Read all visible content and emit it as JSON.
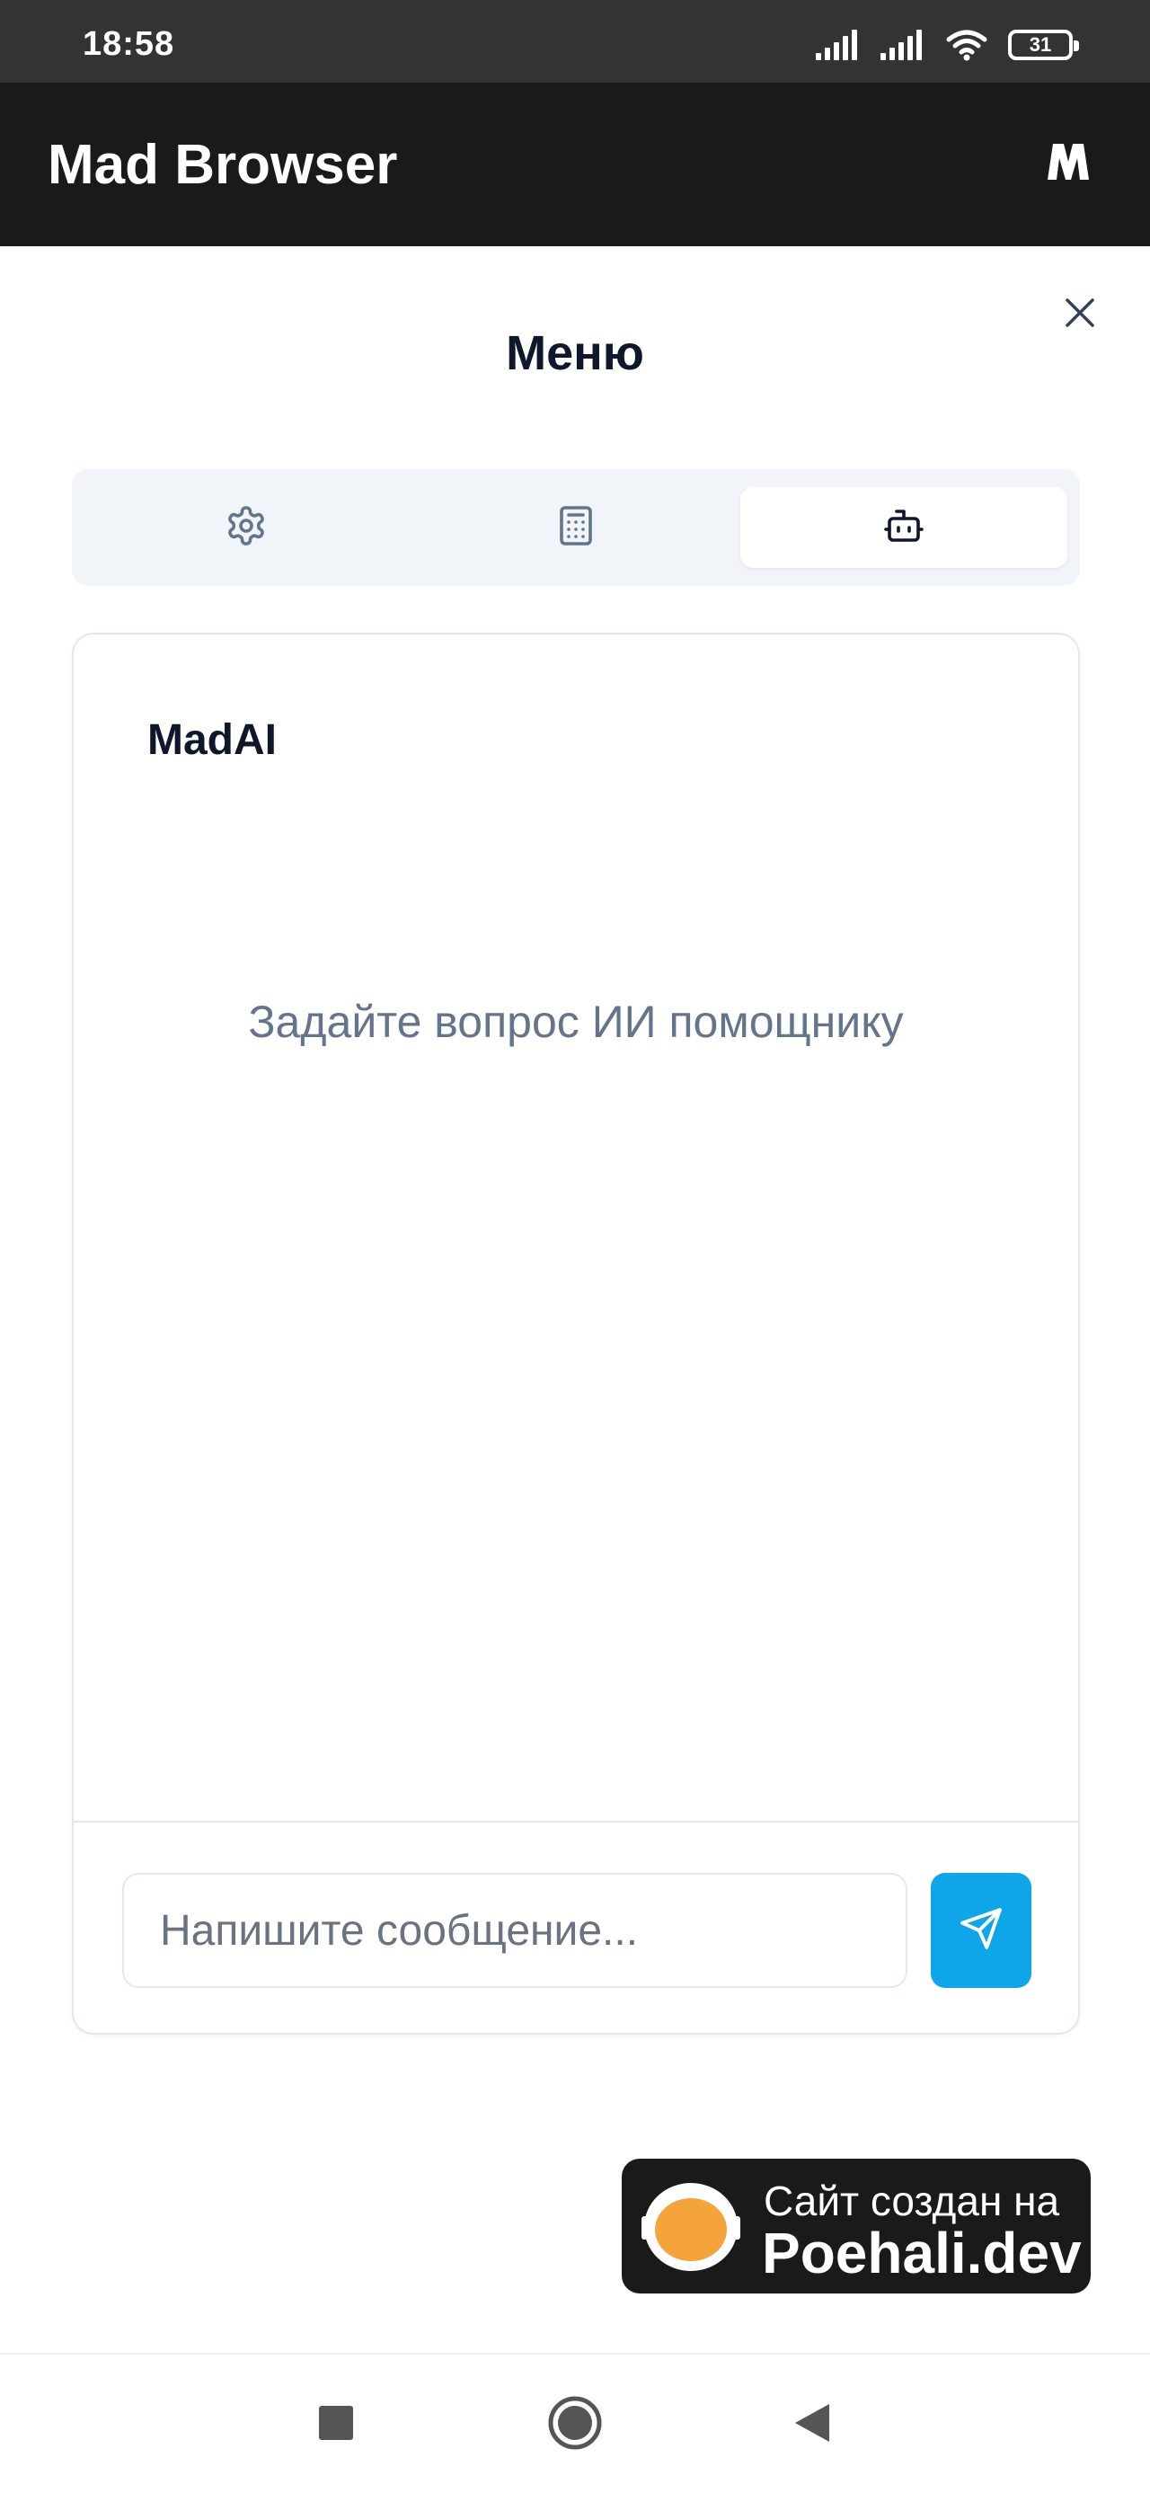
{
  "status_bar": {
    "time": "18:58",
    "battery": "31",
    "icons": [
      "signal-icon",
      "signal-icon",
      "wifi-icon",
      "battery-icon"
    ]
  },
  "app_bar": {
    "title": "Mad Browser",
    "logo_icon": "mad-logo-icon"
  },
  "menu": {
    "title": "Меню",
    "close_icon": "close-icon",
    "tabs": [
      {
        "icon": "gear-icon",
        "active": false
      },
      {
        "icon": "calculator-icon",
        "active": false
      },
      {
        "icon": "bot-icon",
        "active": true
      }
    ]
  },
  "chat": {
    "title": "MadAI",
    "empty_hint": "Задайте вопрос ИИ помощнику",
    "input_placeholder": "Напишите сообщение...",
    "input_value": "",
    "send_icon": "send-icon"
  },
  "badge": {
    "line1": "Сайт создан на",
    "line2": "Poehali.dev"
  },
  "nav": {
    "icons": [
      "recent-apps-icon",
      "home-icon",
      "back-icon"
    ]
  },
  "colors": {
    "appbar_bg": "#1a1a1a",
    "accent": "#0ea5e9",
    "muted_text": "#64748b",
    "badge_orange": "#f5a33b"
  }
}
